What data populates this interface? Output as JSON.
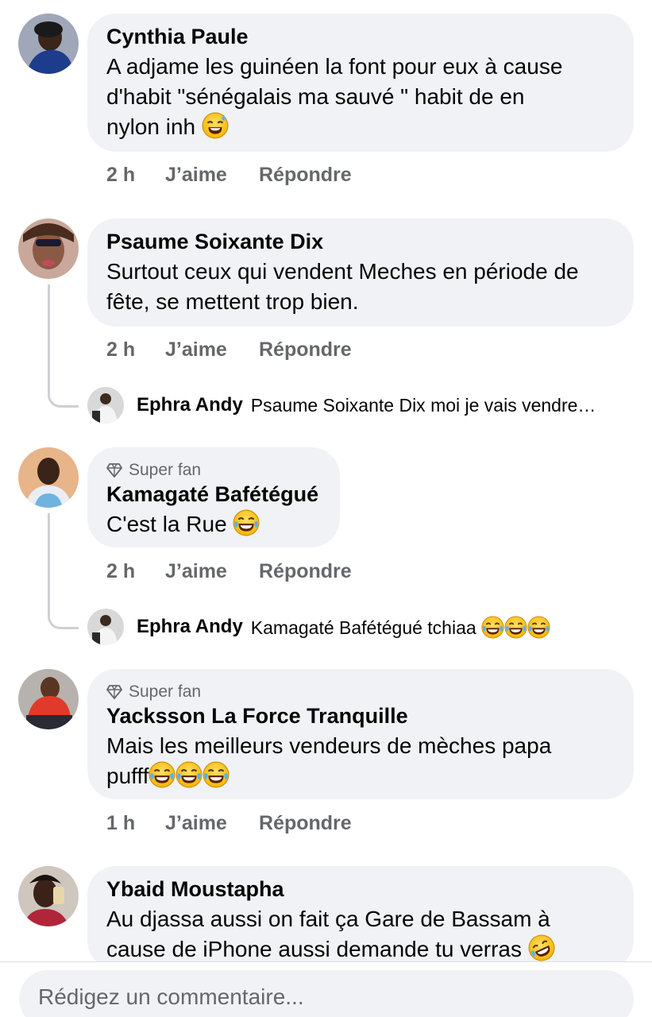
{
  "comments": [
    {
      "author": "Cynthia Paule",
      "text": "A adjame les guinéen la font pour eux à cause\nd'habit \"sénégalais ma sauvé \" habit de en\nnylon inh",
      "emoji": "sweat-smile-emoji",
      "time": "2 h",
      "like_label": "J’aime",
      "reply_label": "Répondre"
    },
    {
      "author": "Psaume Soixante Dix",
      "text": "Surtout ceux qui vendent Meches en période de\nfête, se mettent trop bien.",
      "time": "2 h",
      "like_label": "J’aime",
      "reply_label": "Répondre",
      "reply_preview": {
        "author": "Ephra Andy",
        "text": "Psaume Soixante Dix moi je vais vendre…"
      }
    },
    {
      "badge": "Super fan",
      "author": "Kamagaté Bafétégué",
      "text": "C'est la Rue",
      "emoji": "tears-of-joy-emoji",
      "time": "2 h",
      "like_label": "J’aime",
      "reply_label": "Répondre",
      "reply_preview": {
        "author": "Ephra Andy",
        "text": "Kamagaté Bafétégué tchiaa",
        "emoji_count": 3
      }
    },
    {
      "badge": "Super fan",
      "author": "Yacksson La Force Tranquille",
      "text_line1": "Mais les meilleurs vendeurs de mèches papa",
      "text_line2": "pufff",
      "emoji_count": 3,
      "time": "1 h",
      "like_label": "J’aime",
      "reply_label": "Répondre"
    },
    {
      "author": "Ybaid Moustapha",
      "text_line1": "Au djassa aussi on fait ça Gare de Bassam à",
      "text_line2": "cause de iPhone aussi demande tu verras",
      "emoji": "rofl-emoji"
    }
  ],
  "composer": {
    "placeholder": "Rédigez un commentaire..."
  },
  "colors": {
    "bubble": "#f0f2f5",
    "secondary_text": "#65676b",
    "thread_line": "#ced0d4"
  }
}
